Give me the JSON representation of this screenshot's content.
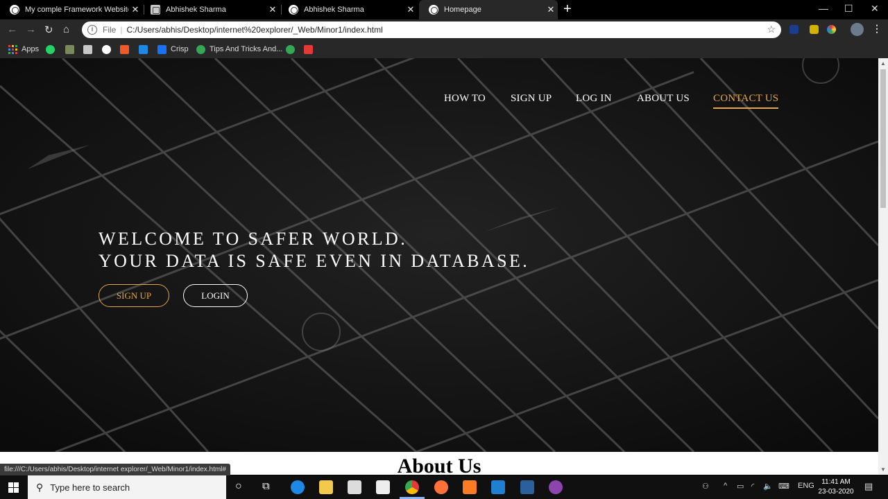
{
  "browser": {
    "tabs": [
      {
        "title": "My comple Framework Website"
      },
      {
        "title": "Abhishek Sharma"
      },
      {
        "title": "Abhishek Sharma"
      },
      {
        "title": "Homepage"
      }
    ],
    "url_scheme": "File",
    "url": "C:/Users/abhis/Desktop/internet%20explorer/_Web/Minor1/index.html",
    "bookmarks": [
      {
        "label": "Apps"
      },
      {
        "label": "Crisp"
      },
      {
        "label": "Tips And Tricks And..."
      }
    ],
    "status_url": "file:///C:/Users/abhis/Desktop/internet explorer/_Web/Minor1/index.html#"
  },
  "page": {
    "nav": [
      "HOW TO",
      "SIGN UP",
      "LOG IN",
      "ABOUT US",
      "CONTACT US"
    ],
    "headline_line1": "WELCOME TO SAFER WORLD.",
    "headline_line2": "YOUR DATA IS SAFE EVEN IN DATABASE.",
    "signup_button": "SIGN UP",
    "login_button": "LOGIN",
    "about_heading": "About Us",
    "accent_color": "#e6a644"
  },
  "taskbar": {
    "search_placeholder": "Type here to search",
    "language": "ENG",
    "time": "11:41 AM",
    "date": "23-03-2020"
  }
}
